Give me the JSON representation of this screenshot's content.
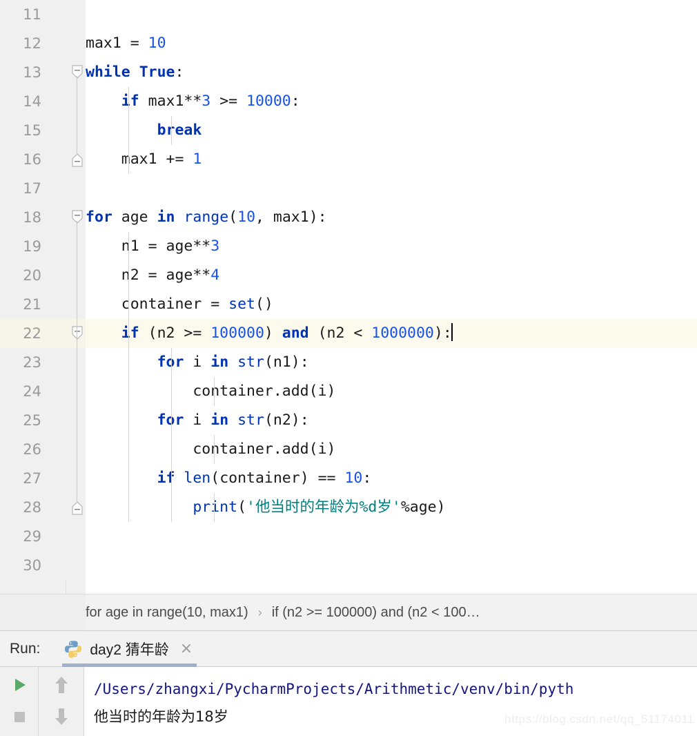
{
  "editor": {
    "first_visible_line": 11,
    "caret_line": 22,
    "highlight_color": "#fcfaed",
    "gutter_color": "#f0f0f0",
    "lines": [
      {
        "n": "11",
        "text": "",
        "fold": "",
        "indent_guides": 0
      },
      {
        "n": "12",
        "text": "max1 = 10",
        "fold": "",
        "indent_guides": 0
      },
      {
        "n": "13",
        "text": "while True:",
        "fold": "collapse-down",
        "indent_guides": 0
      },
      {
        "n": "14",
        "text": "    if max1**3 >= 10000:",
        "fold": "",
        "indent_guides": 1
      },
      {
        "n": "15",
        "text": "        break",
        "fold": "",
        "indent_guides": 2
      },
      {
        "n": "16",
        "text": "    max1 += 1",
        "fold": "collapse-up",
        "indent_guides": 1
      },
      {
        "n": "17",
        "text": "",
        "fold": "",
        "indent_guides": 0
      },
      {
        "n": "18",
        "text": "for age in range(10, max1):",
        "fold": "collapse-down",
        "indent_guides": 0
      },
      {
        "n": "19",
        "text": "    n1 = age**3",
        "fold": "",
        "indent_guides": 1
      },
      {
        "n": "20",
        "text": "    n2 = age**4",
        "fold": "",
        "indent_guides": 1
      },
      {
        "n": "21",
        "text": "    container = set()",
        "fold": "",
        "indent_guides": 1
      },
      {
        "n": "22",
        "text": "    if (n2 >= 100000) and (n2 < 1000000):",
        "fold": "collapse-down",
        "indent_guides": 1
      },
      {
        "n": "23",
        "text": "        for i in str(n1):",
        "fold": "",
        "indent_guides": 2
      },
      {
        "n": "24",
        "text": "            container.add(i)",
        "fold": "",
        "indent_guides": 3
      },
      {
        "n": "25",
        "text": "        for i in str(n2):",
        "fold": "",
        "indent_guides": 2
      },
      {
        "n": "26",
        "text": "            container.add(i)",
        "fold": "",
        "indent_guides": 3
      },
      {
        "n": "27",
        "text": "        if len(container) == 10:",
        "fold": "",
        "indent_guides": 2
      },
      {
        "n": "28",
        "text": "            print('他当时的年龄为%d岁'%age)",
        "fold": "collapse-up",
        "indent_guides": 3
      },
      {
        "n": "29",
        "text": "",
        "fold": "",
        "indent_guides": 0
      },
      {
        "n": "30",
        "text": "",
        "fold": "",
        "indent_guides": 0
      }
    ]
  },
  "breadcrumb": {
    "items": [
      "for age in range(10, max1)",
      "if (n2 >= 100000) and (n2 < 100…"
    ],
    "separator": "›"
  },
  "run_panel": {
    "label": "Run:",
    "tab": {
      "icon": "python-icon",
      "title": "day2 猜年龄",
      "close": "×"
    },
    "toolbar": {
      "run_button": "run-icon",
      "stop_button": "stop-icon",
      "up_button": "arrow-up-icon",
      "down_button": "arrow-down-icon"
    },
    "console": [
      {
        "kind": "path",
        "text": "/Users/zhangxi/PycharmProjects/Arithmetic/venv/bin/pyth"
      },
      {
        "kind": "out",
        "text": "他当时的年龄为18岁"
      }
    ]
  },
  "watermark": "https://blog.csdn.net/qq_51174011",
  "colors": {
    "keyword": "#0033b3",
    "number": "#1750eb",
    "string": "#008080",
    "console_path": "#151580",
    "highlight_row": "#fcfaed",
    "run_green": "#59a869",
    "tab_underline": "#9fb0cc"
  }
}
